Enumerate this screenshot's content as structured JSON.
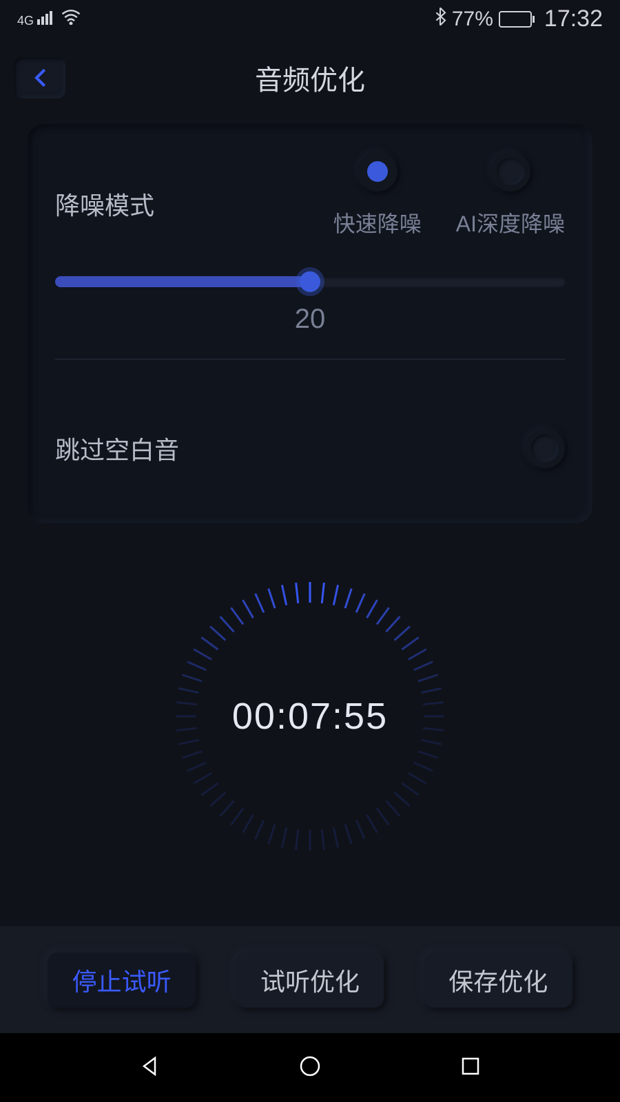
{
  "status_bar": {
    "network_type": "4G",
    "bluetooth_icon": "bluetooth-icon",
    "battery_percent": "77%",
    "time": "17:32"
  },
  "header": {
    "title": "音频优化"
  },
  "noise_reduction": {
    "label": "降噪模式",
    "options": {
      "fast": "快速降噪",
      "ai_deep": "AI深度降噪"
    },
    "selected": "fast",
    "slider_value": "20",
    "slider_percent": 50
  },
  "skip_silence": {
    "label": "跳过空白音",
    "enabled": false
  },
  "timer": {
    "value": "00:07:55"
  },
  "actions": {
    "stop_preview": "停止试听",
    "preview_optimize": "试听优化",
    "save_optimize": "保存优化"
  },
  "colors": {
    "accent": "#3a5adb",
    "dark_bg": "#0f1218"
  }
}
